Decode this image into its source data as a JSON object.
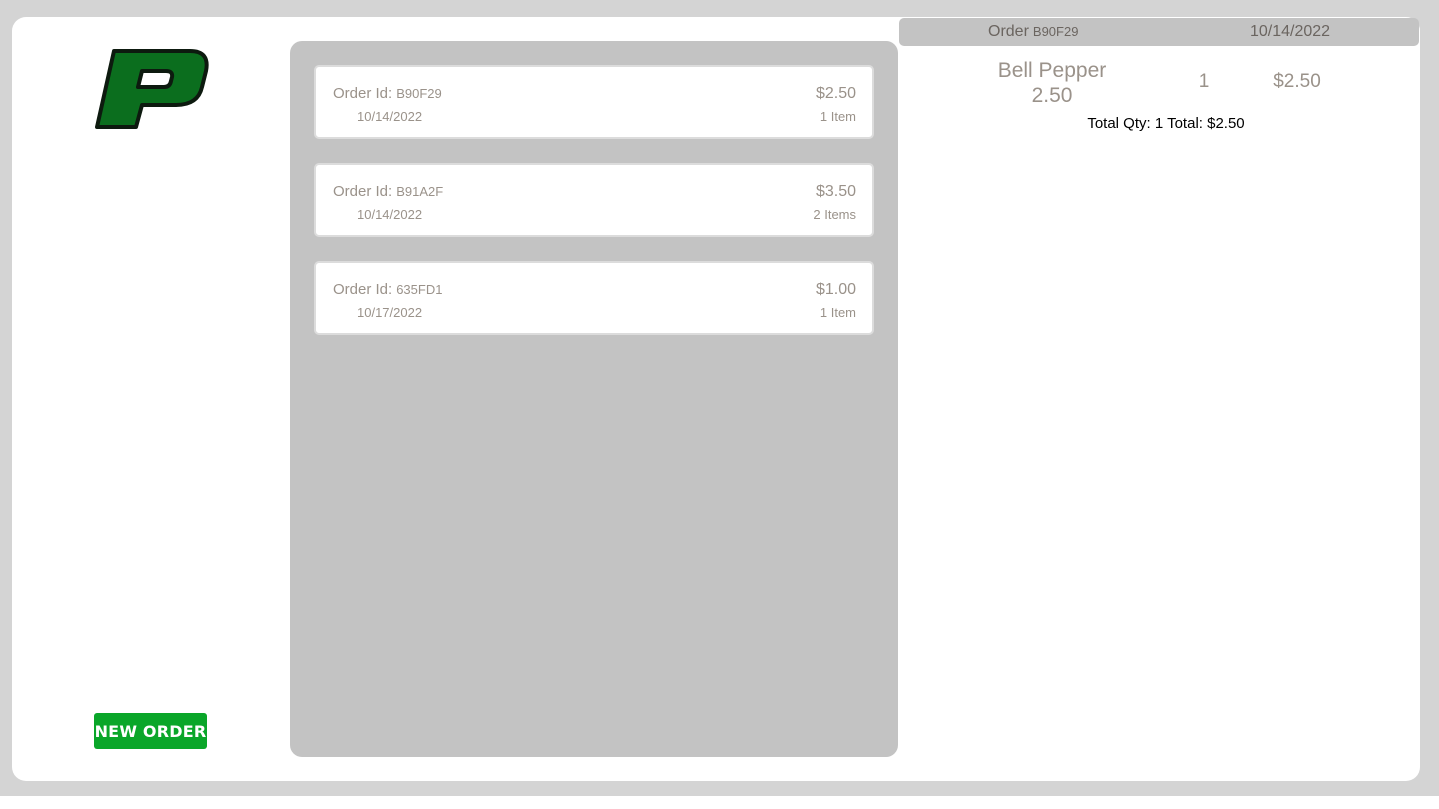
{
  "brand": {
    "logo_letter": "P",
    "logo_fill": "#0b6e1e",
    "logo_stroke": "#0d1a0f"
  },
  "sidebar": {
    "new_order_label": "NEW ORDER",
    "new_order_color": "#0aa629"
  },
  "orders": [
    {
      "id_label": "Order Id:",
      "id": "B90F29",
      "date": "10/14/2022",
      "price": "$2.50",
      "items": "1 Item"
    },
    {
      "id_label": "Order Id:",
      "id": "B91A2F",
      "date": "10/14/2022",
      "price": "$3.50",
      "items": "2 Items"
    },
    {
      "id_label": "Order Id:",
      "id": "635FD1",
      "date": "10/17/2022",
      "price": "$1.00",
      "items": "1 Item"
    }
  ],
  "detail": {
    "order_label": "Order",
    "order_id": "B90F29",
    "date": "10/14/2022",
    "line_items": [
      {
        "name": "Bell Pepper",
        "unit_price": "2.50",
        "qty": "1",
        "total": "$2.50"
      }
    ],
    "totals_text": "Total Qty: 1 Total: $2.50"
  }
}
